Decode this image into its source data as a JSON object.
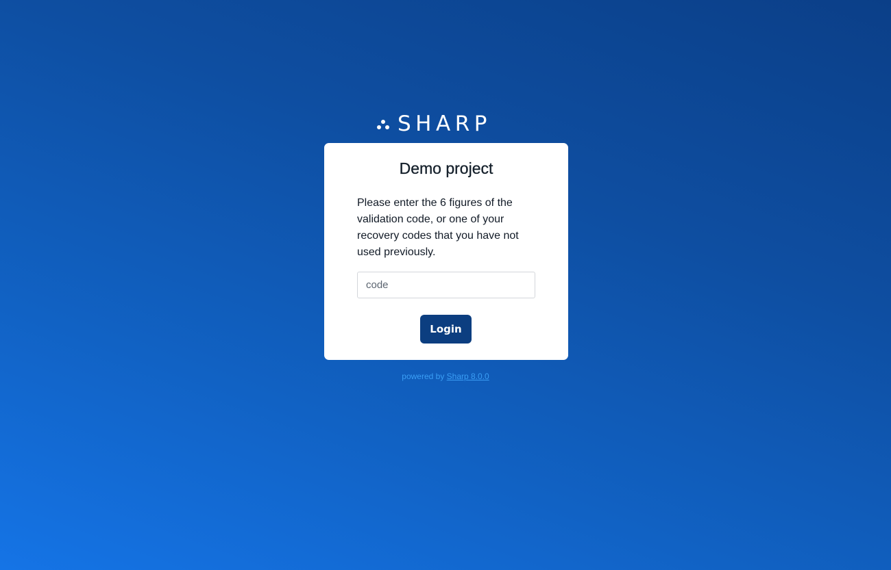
{
  "logo": {
    "text": "SHARP",
    "icon": "three-dots-logo-icon"
  },
  "card": {
    "title": "Demo project",
    "message": "Please enter the 6 figures of the validation code, or one of your recovery codes that you have not used previously.",
    "code_input": {
      "placeholder": "code",
      "value": ""
    },
    "login_label": "Login"
  },
  "footer": {
    "powered_by": "powered by",
    "link_text": "Sharp 8.0.0"
  },
  "colors": {
    "background_top": "#0b3f88",
    "background_bottom": "#1574e6",
    "button": "#0c3e80",
    "footer_text": "#3a9ef5"
  }
}
